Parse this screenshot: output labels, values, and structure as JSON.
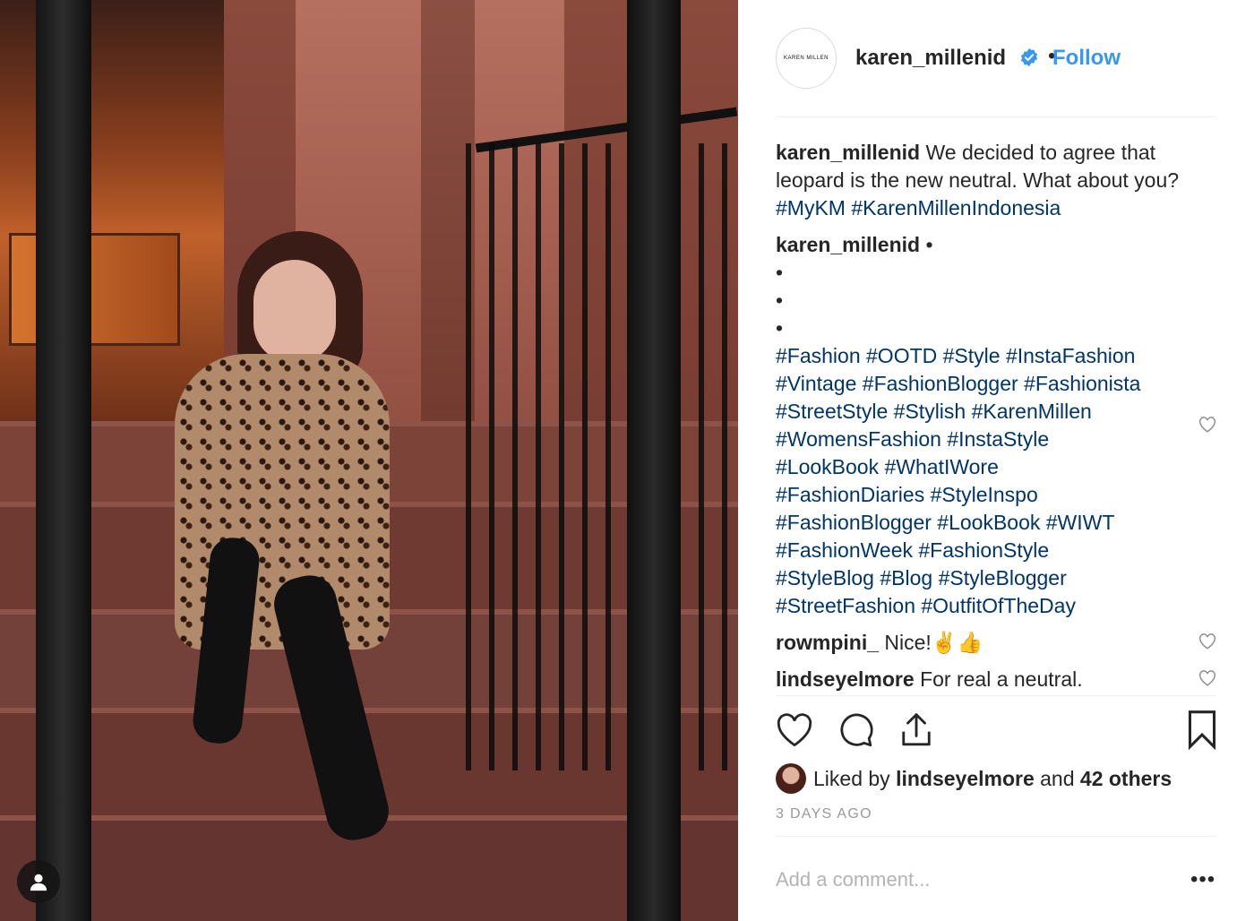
{
  "post": {
    "username": "karen_millenid",
    "logo_text": "KAREN MILLEN",
    "follow_label": "Follow",
    "separator": "•",
    "caption_text": "We decided to agree that leopard is the new neutral. What about you?",
    "caption_tags": "#MyKM #KarenMillenIndonesia"
  },
  "comments": {
    "author_comment_user": "karen_millenid",
    "author_comment_first": "•",
    "bullets": [
      "•",
      "•",
      "•"
    ],
    "hashtag_lines": [
      "#Fashion #OOTD #Style #InstaFashion",
      "#Vintage #FashionBlogger #Fashionista",
      "#StreetStyle #Stylish #KarenMillen",
      "#WomensFashion #InstaStyle",
      "#LookBook #WhatIWore",
      "#FashionDiaries #StyleInspo",
      "#FashionBlogger #LookBook #WIWT",
      "#FashionWeek #FashionStyle",
      "#StyleBlog #Blog #StyleBlogger",
      "#StreetFashion #OutfitOfTheDay"
    ],
    "c1_user": "rowmpini_",
    "c1_text": "Nice!✌️👍",
    "c2_user": "lindseyelmore",
    "c2_text": "For real a neutral."
  },
  "likes": {
    "prefix": "Liked by",
    "user": "lindseyelmore",
    "and": "and",
    "others": "42 others"
  },
  "timestamp": "3 DAYS AGO",
  "add_comment_placeholder": "Add a comment...",
  "more_label": "•••",
  "icons": [
    "heart-icon",
    "comment-icon",
    "share-icon",
    "bookmark-icon",
    "verified-icon",
    "user-icon",
    "more-icon"
  ]
}
